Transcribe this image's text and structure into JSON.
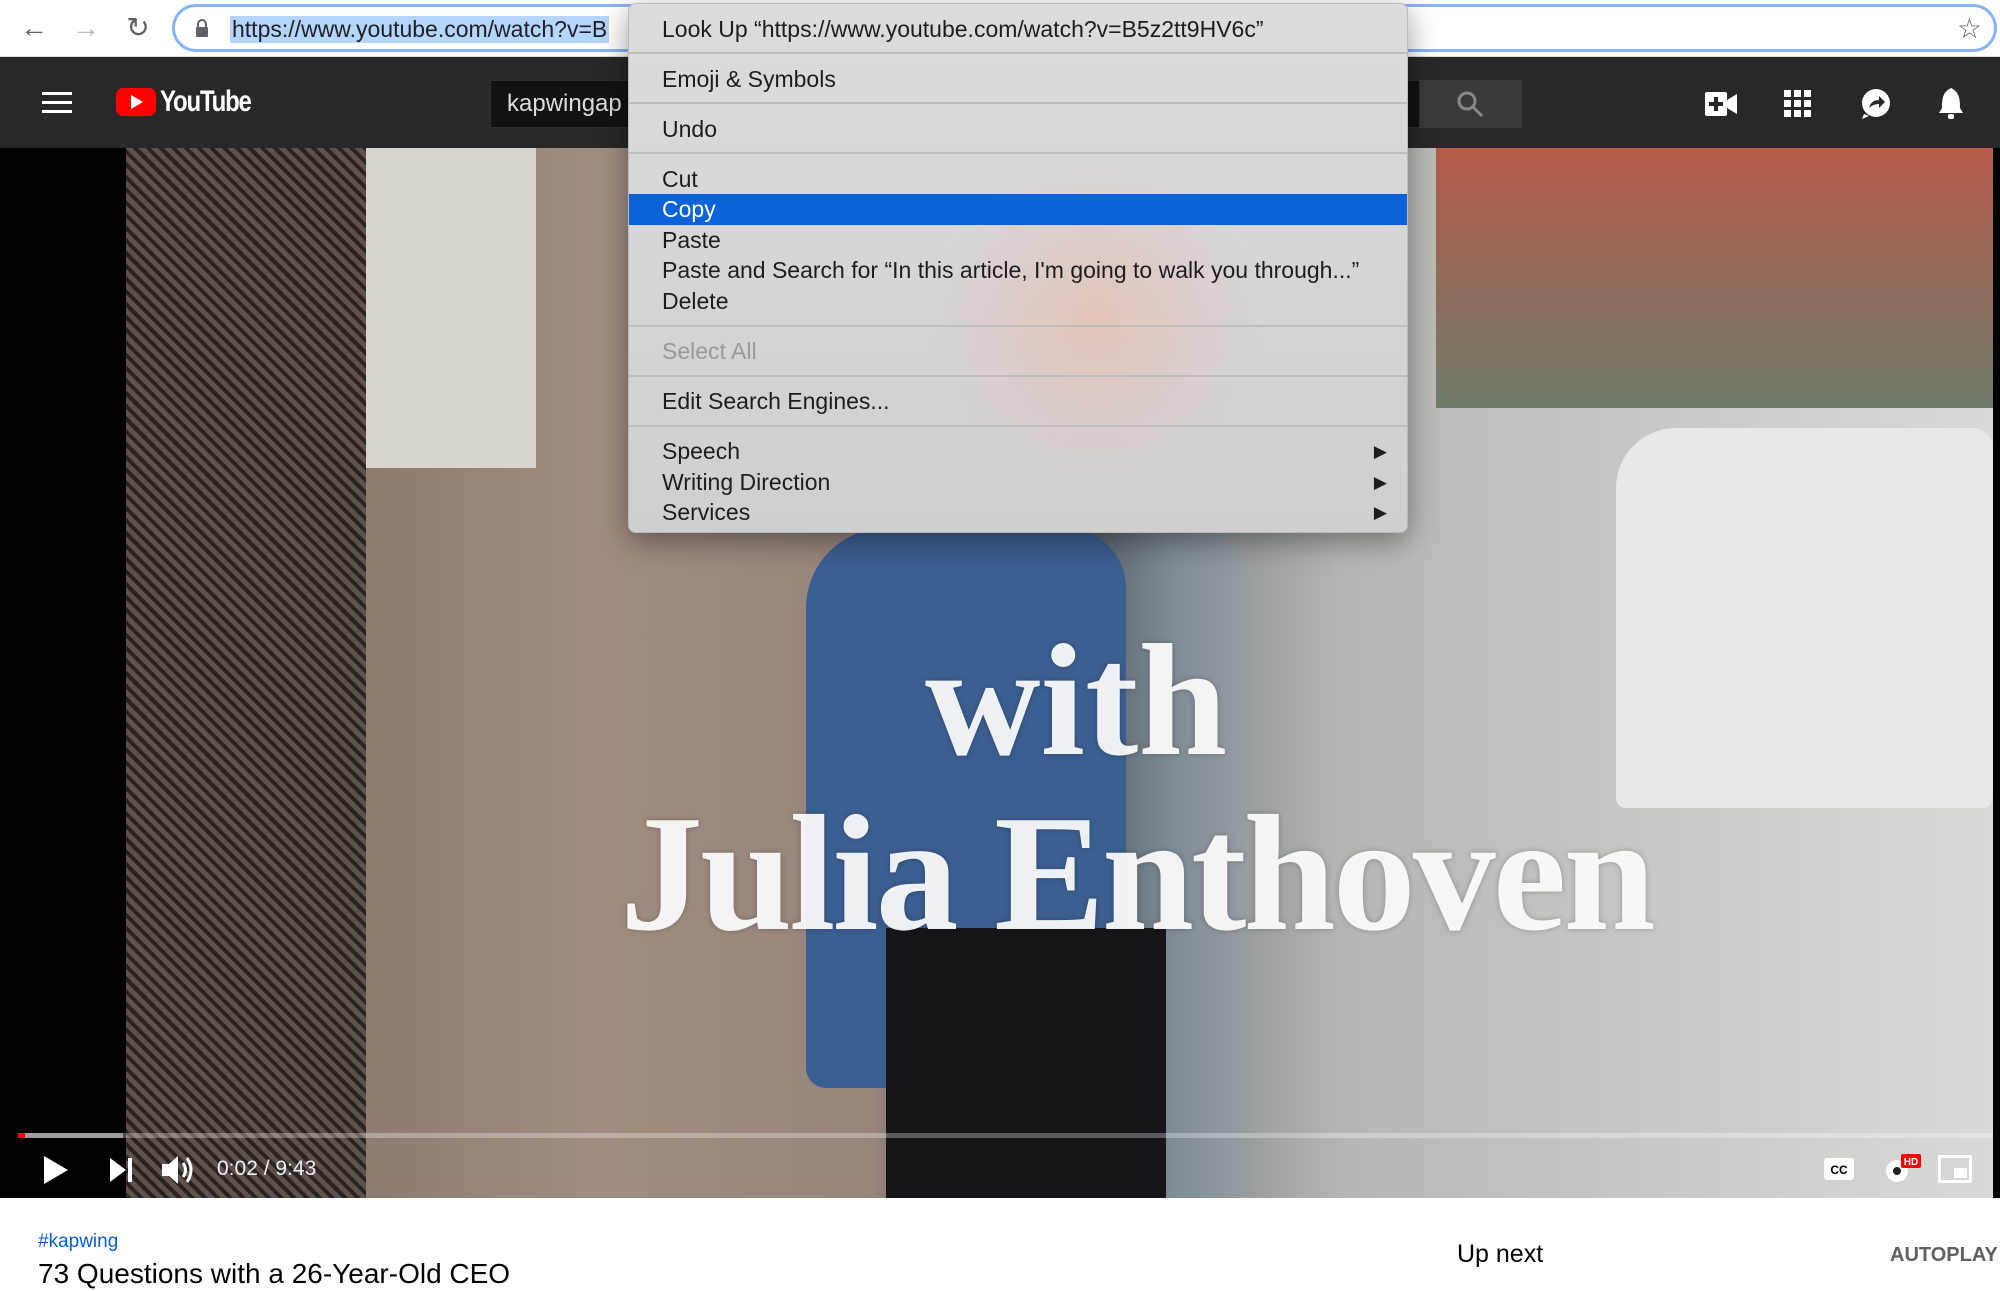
{
  "browser": {
    "url": "https://www.youtube.com/watch?v=B",
    "back": "←",
    "forward": "→",
    "reload": "↻",
    "star": "☆"
  },
  "youtube": {
    "logo_text": "YouTube",
    "search_value": "kapwingap",
    "icons": [
      "create-video-icon",
      "apps-icon",
      "messages-icon",
      "notifications-icon"
    ]
  },
  "video": {
    "overlay_line1": "with",
    "overlay_line2": "Julia Enthoven",
    "time": "0:02 / 9:43",
    "progress_fraction": 0.0035,
    "buffer_fraction": 0.053,
    "accent": "#ff0000"
  },
  "info": {
    "hashtag": "#kapwing",
    "title": "73 Questions with a 26-Year-Old CEO",
    "up_next": "Up next",
    "autoplay": "AUTOPLAY"
  },
  "context_menu": {
    "look_up": "Look Up “https://www.youtube.com/watch?v=B5z2tt9HV6c”",
    "emoji": "Emoji & Symbols",
    "undo": "Undo",
    "cut": "Cut",
    "copy": "Copy",
    "paste": "Paste",
    "paste_search": "Paste and Search for “In this article, I'm going to walk you through...”",
    "delete": "Delete",
    "select_all": "Select All",
    "edit_engines": "Edit Search Engines...",
    "speech": "Speech",
    "writing_direction": "Writing Direction",
    "services": "Services",
    "submenu_arrow": "▶",
    "highlight": "#0a63d9"
  }
}
